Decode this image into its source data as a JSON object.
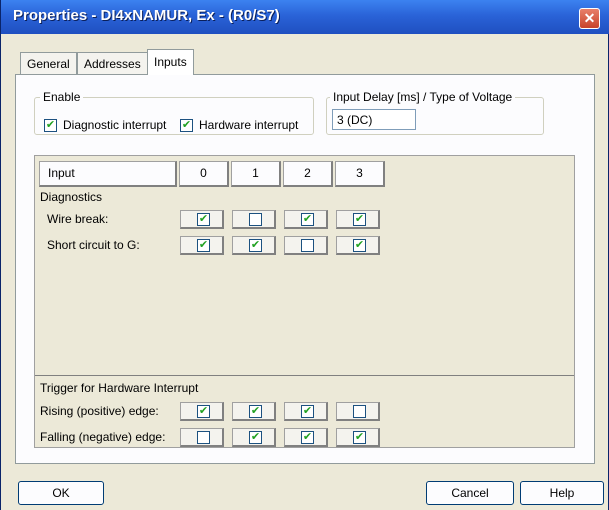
{
  "window": {
    "title": "Properties - DI4xNAMUR, Ex - (R0/S7)",
    "close_glyph": "✕"
  },
  "tabs": [
    {
      "label": "General",
      "active": false
    },
    {
      "label": "Addresses",
      "active": false
    },
    {
      "label": "Inputs",
      "active": true
    }
  ],
  "enable": {
    "label": "Enable",
    "diagnostic_interrupt": {
      "label": "Diagnostic interrupt",
      "checked": true
    },
    "hardware_interrupt": {
      "label": "Hardware interrupt",
      "checked": true
    }
  },
  "input_delay": {
    "label": "Input Delay [ms] / Type of Voltage",
    "value": "3 (DC)"
  },
  "grid": {
    "header_label": "Input",
    "columns": [
      "0",
      "1",
      "2",
      "3"
    ],
    "diagnostics_label": "Diagnostics",
    "diagnostics_rows": [
      {
        "label": "Wire break:",
        "values": [
          true,
          false,
          true,
          true
        ]
      },
      {
        "label": "Short circuit to G:",
        "values": [
          true,
          true,
          false,
          true
        ]
      }
    ],
    "trigger_label": "Trigger for Hardware Interrupt",
    "trigger_rows": [
      {
        "label": "Rising (positive) edge:",
        "values": [
          true,
          true,
          true,
          false
        ]
      },
      {
        "label": "Falling (negative) edge:",
        "values": [
          false,
          true,
          true,
          true
        ]
      }
    ]
  },
  "buttons": {
    "ok": "OK",
    "cancel": "Cancel",
    "help": "Help"
  },
  "check_glyph": "✔",
  "colors": {
    "titlebar": "#2a63d8",
    "check": "#21a121"
  }
}
